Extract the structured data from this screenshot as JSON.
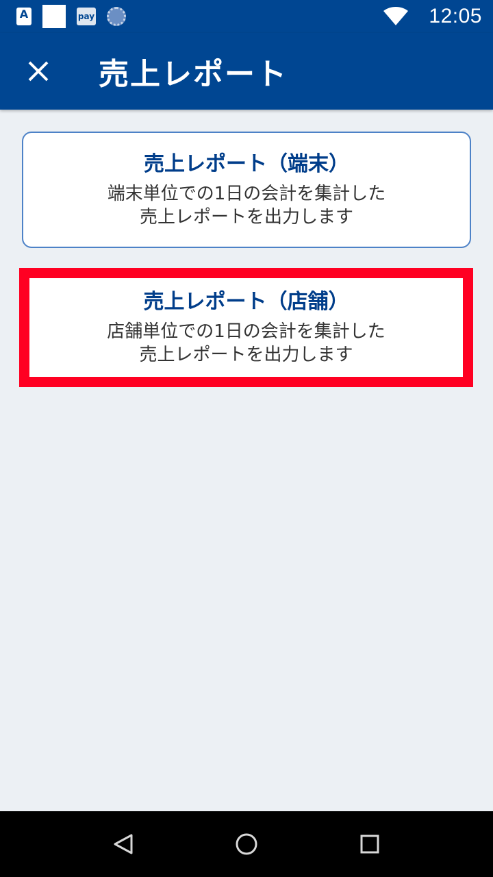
{
  "status_bar": {
    "icons": [
      "a-app-icon",
      "blank-app-icon",
      "pay-app-icon",
      "dial-app-icon"
    ],
    "a_icon_text": "A",
    "pay_icon_text": "pay",
    "time": "12:05"
  },
  "app_bar": {
    "title": "売上レポート",
    "close_icon": "close-icon",
    "background": "#004692"
  },
  "cards": [
    {
      "title": "売上レポート（端末）",
      "desc_line1": "端末単位での1日の会計を集計した",
      "desc_line2": "売上レポートを出力します"
    },
    {
      "title": "売上レポート（店舗）",
      "desc_line1": "店舗単位での1日の会計を集計した",
      "desc_line2": "売上レポートを出力します",
      "highlight_color": "#ff0022"
    }
  ],
  "nav_bar": {
    "icons": [
      "back-icon",
      "home-icon",
      "recents-icon"
    ]
  }
}
